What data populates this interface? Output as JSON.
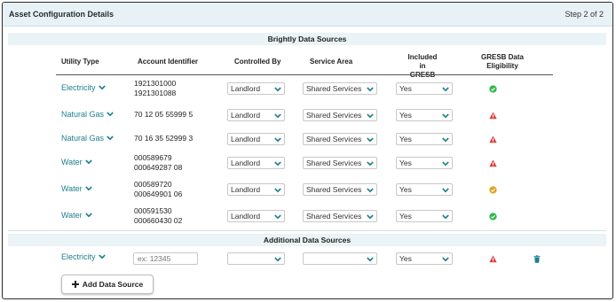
{
  "header": {
    "title": "Asset Configuration Details",
    "step": "Step 2 of 2"
  },
  "sections": {
    "brightly": "Brightly Data Sources",
    "additional": "Additional Data Sources"
  },
  "columns": {
    "utility_type": "Utility Type",
    "account_identifier": "Account Identifier",
    "controlled_by": "Controlled By",
    "service_area": "Service Area",
    "included_line1": "Included in",
    "included_line2": "GRESB",
    "eligibility_line1": "GRESB Data",
    "eligibility_line2": "Eligibility"
  },
  "rows": [
    {
      "utility": "Electricity",
      "acct1": "1921301000",
      "acct2": "1921301088",
      "controlled_by": "Landlord",
      "service_area": "Shared Services",
      "included": "Yes",
      "eligibility": "check-green"
    },
    {
      "utility": "Natural Gas",
      "acct1": "70 12 05 55999 5",
      "acct2": "",
      "controlled_by": "Landlord",
      "service_area": "Shared Services",
      "included": "Yes",
      "eligibility": "warning-red"
    },
    {
      "utility": "Natural Gas",
      "acct1": "70 16 35 52999 3",
      "acct2": "",
      "controlled_by": "Landlord",
      "service_area": "Shared Services",
      "included": "Yes",
      "eligibility": "warning-red"
    },
    {
      "utility": "Water",
      "acct1": "000589679",
      "acct2": "000649287 08",
      "controlled_by": "Landlord",
      "service_area": "Shared Services",
      "included": "Yes",
      "eligibility": "warning-red"
    },
    {
      "utility": "Water",
      "acct1": "000589720",
      "acct2": "000649901 06",
      "controlled_by": "Landlord",
      "service_area": "Shared Services",
      "included": "Yes",
      "eligibility": "check-orange"
    },
    {
      "utility": "Water",
      "acct1": "000591530",
      "acct2": "000660430 02",
      "controlled_by": "Landlord",
      "service_area": "Shared Services",
      "included": "Yes",
      "eligibility": "check-green"
    }
  ],
  "additional": {
    "utility": "Electricity",
    "account_placeholder": "ex: 12345",
    "controlled_by": "",
    "service_area": "",
    "included": "Yes",
    "eligibility": "warning-red"
  },
  "add_button": {
    "label": "Add Data Source",
    "icon": "plus-icon"
  },
  "colors": {
    "accent": "#1e7f8c",
    "header_bg": "#e8f2f6",
    "green": "#2eb84a",
    "red": "#e03b3b",
    "orange": "#e3a21a"
  }
}
